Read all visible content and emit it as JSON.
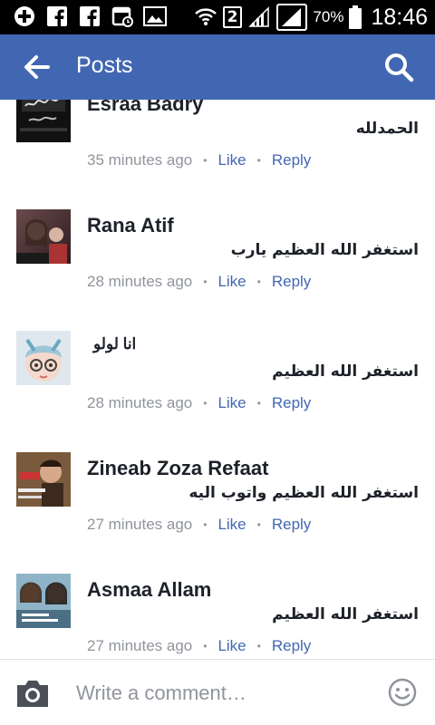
{
  "status_bar": {
    "sim_slot": "2",
    "battery_percent": "70%",
    "time": "18:46",
    "icons": [
      "add-icon",
      "facebook-icon",
      "facebook-icon",
      "calendar-icon",
      "gallery-icon",
      "wifi-icon",
      "sim-icon",
      "signal-icon",
      "signal-icon",
      "battery-icon"
    ]
  },
  "app_bar": {
    "title": "Posts",
    "accent": "#4267b2"
  },
  "comments": [
    {
      "name": "Esraa Badry",
      "text": "الحمدلله",
      "time": "35 minutes ago",
      "like": "Like",
      "reply": "Reply"
    },
    {
      "name": "Rana Atif",
      "text": "استغفر الله العظيم يارب",
      "time": "28 minutes ago",
      "like": "Like",
      "reply": "Reply"
    },
    {
      "name": "انا لولو",
      "text": "استغفر الله العظيم",
      "time": "28 minutes ago",
      "like": "Like",
      "reply": "Reply"
    },
    {
      "name": "Zineab Zoza Refaat",
      "text": "استغفر الله العظيم واتوب اليه",
      "time": "27 minutes ago",
      "like": "Like",
      "reply": "Reply"
    },
    {
      "name": "Asmaa Allam",
      "text": "استغفر الله العظيم",
      "time": "27 minutes ago",
      "like": "Like",
      "reply": "Reply"
    }
  ],
  "composer": {
    "placeholder": "Write a comment…"
  }
}
